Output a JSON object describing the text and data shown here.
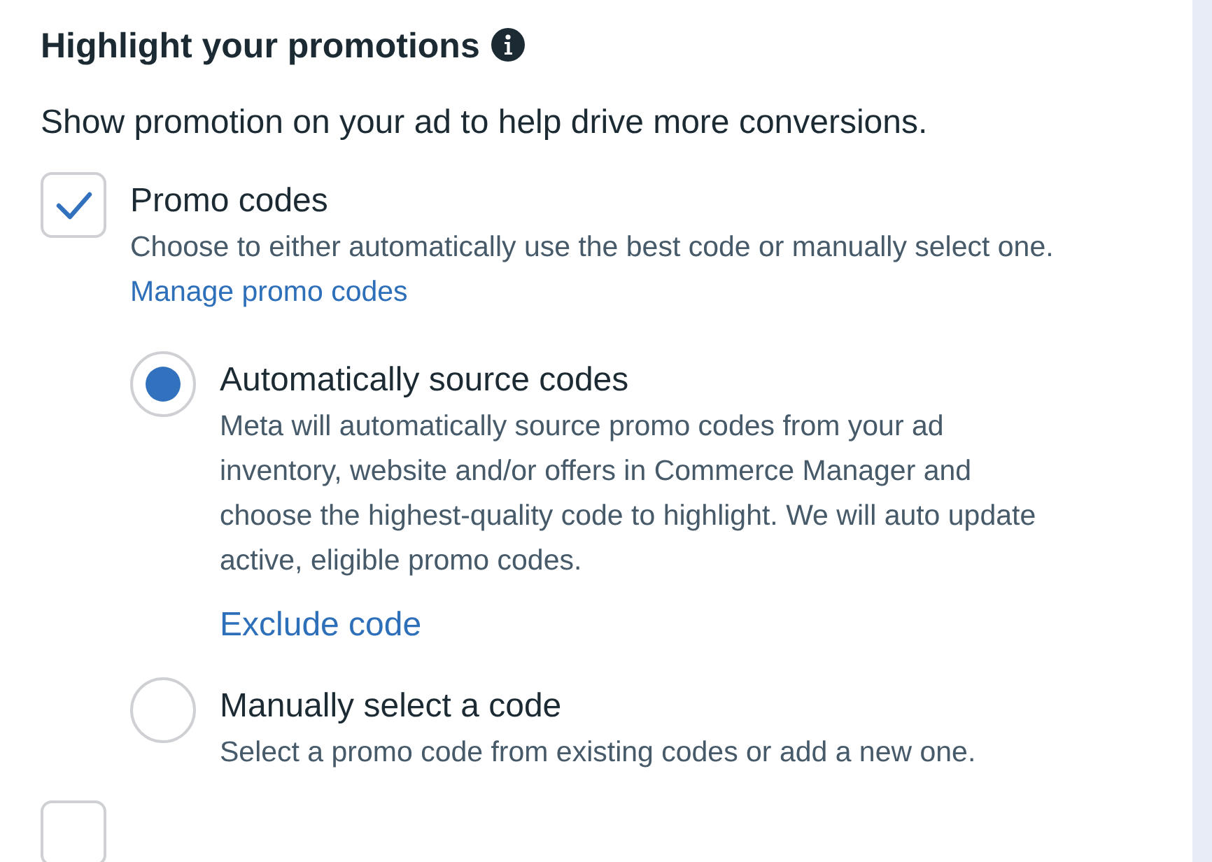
{
  "section": {
    "title": "Highlight your promotions",
    "subtitle": "Show promotion on your ad to help drive more conversions."
  },
  "options": [
    {
      "label": "Promo codes",
      "checked": true,
      "description": "Choose to either automatically use the best code or manually select one.",
      "link": "Manage promo codes",
      "choices": [
        {
          "label": "Automatically source codes",
          "selected": true,
          "description": "Meta will automatically source promo codes from your ad inventory, website and/or offers in Commerce Manager and choose the highest-quality code to highlight. We will auto update active, eligible promo codes.",
          "link": "Exclude code"
        },
        {
          "label": "Manually select a code",
          "selected": false,
          "description": "Select a promo code from existing codes or add a new one."
        }
      ]
    },
    {
      "checked": false
    }
  ]
}
